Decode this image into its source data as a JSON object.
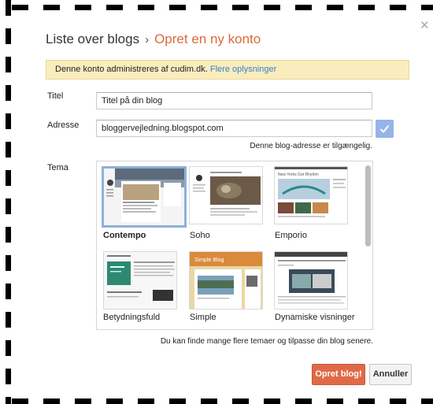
{
  "header": {
    "breadcrumb_parent": "Liste over blogs",
    "separator": "›",
    "breadcrumb_current": "Opret en ny konto"
  },
  "notice": {
    "text": "Denne konto administreres af cudim.dk.",
    "link": "Flere oplysninger"
  },
  "form": {
    "title_label": "Titel",
    "title_value": "Titel på din blog",
    "address_label": "Adresse",
    "address_value": "bloggervejledning.blogspot.com",
    "address_status": "Denne blog-adresse er tilgængelig.",
    "theme_label": "Tema"
  },
  "themes": [
    {
      "name": "Contempo",
      "selected": true
    },
    {
      "name": "Soho",
      "selected": false
    },
    {
      "name": "Emporio",
      "selected": false
    },
    {
      "name": "Betydningsfuld",
      "selected": false
    },
    {
      "name": "Simple",
      "selected": false
    },
    {
      "name": "Dynamiske visninger",
      "selected": false
    }
  ],
  "theme_preview_text": {
    "emporio": "New Yorks Got Rhythm",
    "simple": "Simple Blog"
  },
  "footnote": "Du kan finde mange flere temaer og tilpasse din blog senere.",
  "buttons": {
    "create": "Opret blog!",
    "cancel": "Annuller"
  },
  "icons": {
    "close": "close-icon",
    "check": "check-icon"
  },
  "colors": {
    "accent": "#dd6a3a",
    "primary_button": "#e06a47",
    "notice_bg": "#f9edbe",
    "link": "#3f7ec4",
    "check_bg": "#96b4ea"
  }
}
